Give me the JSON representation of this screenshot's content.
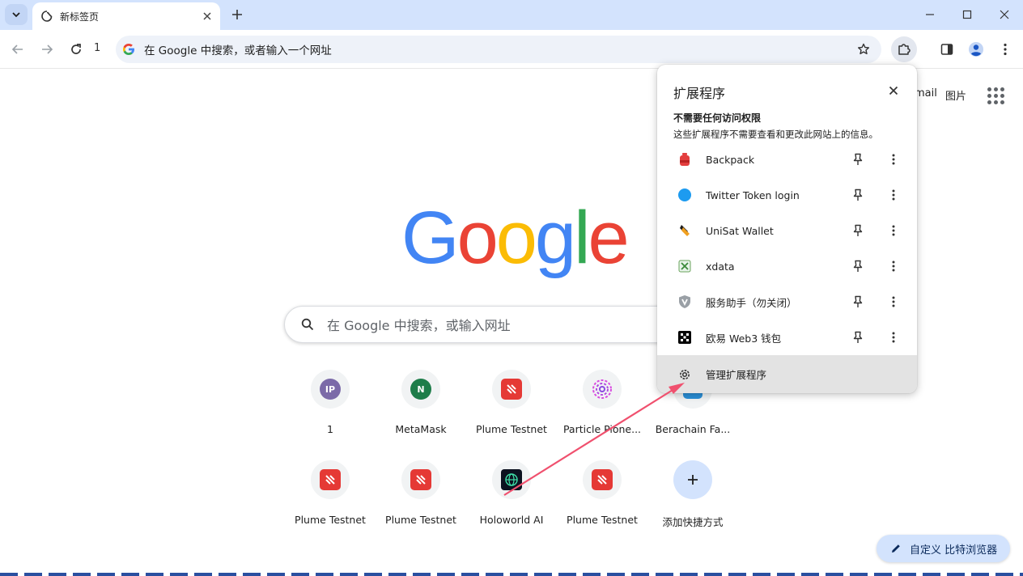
{
  "tab": {
    "title": "新标签页"
  },
  "toolbar": {
    "profile_number": "1",
    "omnibox_placeholder": "在 Google 中搜索，或者输入一个网址"
  },
  "page": {
    "top_links": [
      "mail",
      "图片"
    ],
    "logo_letters": [
      {
        "char": "G",
        "color": "#4285F4"
      },
      {
        "char": "o",
        "color": "#EA4335"
      },
      {
        "char": "o",
        "color": "#FBBC05"
      },
      {
        "char": "g",
        "color": "#4285F4"
      },
      {
        "char": "l",
        "color": "#34A853"
      },
      {
        "char": "e",
        "color": "#EA4335"
      }
    ],
    "search_placeholder": "在 Google 中搜索，或输入网址",
    "shortcuts_row1": [
      "1",
      "MetaMask",
      "Plume Testnet",
      "Particle Pione...",
      "Berachain Fa..."
    ],
    "shortcuts_row2": [
      "Plume Testnet",
      "Plume Testnet",
      "Holoworld AI",
      "Plume Testnet",
      "添加快捷方式"
    ],
    "shortcut_icons": {
      "ip": "IP",
      "metamask": "N"
    },
    "customize_label": "自定义 比特浏览器"
  },
  "extensions_popup": {
    "title": "扩展程序",
    "section_title": "不需要任何访问权限",
    "section_desc": "这些扩展程序不需要查看和更改此网站上的信息。",
    "items": [
      {
        "name": "Backpack",
        "icon": "backpack-icon"
      },
      {
        "name": "Twitter Token login",
        "icon": "blue-dot-icon"
      },
      {
        "name": "UniSat Wallet",
        "icon": "unisat-icon"
      },
      {
        "name": "xdata",
        "icon": "xdata-icon"
      },
      {
        "name": "服务助手（勿关闭）",
        "icon": "shield-icon"
      },
      {
        "name": "欧易 Web3 钱包",
        "icon": "okx-icon"
      }
    ],
    "manage_label": "管理扩展程序"
  },
  "colors": {
    "accent": "#d3e3fd",
    "annotation_arrow": "#f0506e"
  }
}
